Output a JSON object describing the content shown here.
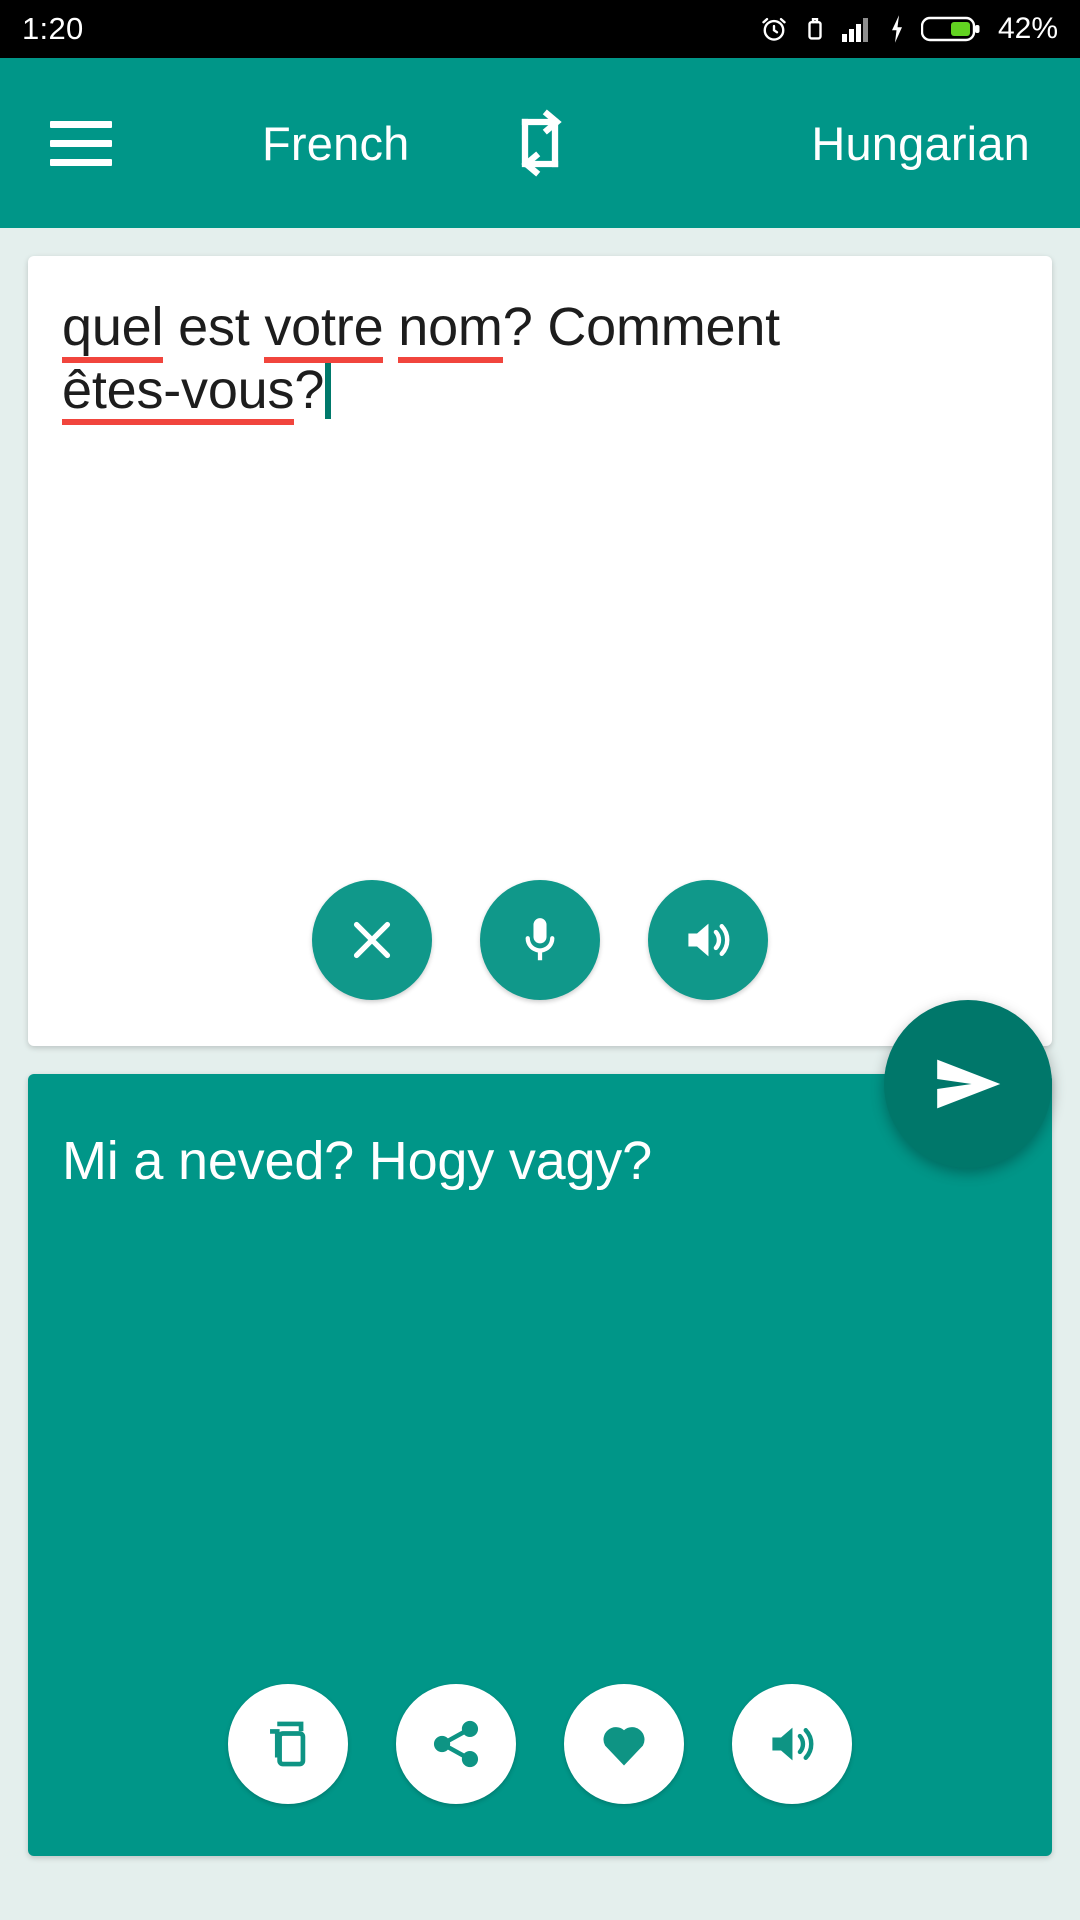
{
  "statusbar": {
    "time": "1:20",
    "battery_percent": "42%",
    "icons": [
      "alarm-icon",
      "vibrate-icon",
      "signal-icon",
      "charging-bolt-icon",
      "battery-icon"
    ]
  },
  "toolbar": {
    "menu_icon": "hamburger-menu-icon",
    "source_language": "French",
    "swap_icon": "swap-languages-icon",
    "target_language": "Hungarian",
    "background_color": "#009688"
  },
  "source": {
    "text_full": "quel est votre nom? Comment êtes-vous?",
    "tokens": [
      {
        "text": "quel",
        "misspelled": true
      },
      {
        "text": " ",
        "misspelled": false
      },
      {
        "text": "est",
        "misspelled": false
      },
      {
        "text": " ",
        "misspelled": false
      },
      {
        "text": "votre",
        "misspelled": true
      },
      {
        "text": " ",
        "misspelled": false
      },
      {
        "text": "nom",
        "misspelled": true
      },
      {
        "text": "? Comment ",
        "misspelled": false
      },
      {
        "text": "êtes-vous",
        "misspelled": true
      },
      {
        "text": "?",
        "misspelled": false
      }
    ],
    "caret_visible": true,
    "spellcheck_underline_color": "#f1453d",
    "caret_color": "#00796b",
    "actions": [
      {
        "name": "clear-button",
        "icon": "close-icon"
      },
      {
        "name": "voice-input-button",
        "icon": "microphone-icon"
      },
      {
        "name": "speak-source-button",
        "icon": "speaker-icon"
      }
    ]
  },
  "send": {
    "label": "send-button",
    "icon": "send-icon",
    "color": "#00776a"
  },
  "result": {
    "text": "Mi a neved? Hogy vagy?",
    "background_color": "#009688",
    "actions": [
      {
        "name": "copy-button",
        "icon": "copy-icon"
      },
      {
        "name": "share-button",
        "icon": "share-icon"
      },
      {
        "name": "favorite-button",
        "icon": "heart-icon"
      },
      {
        "name": "speak-result-button",
        "icon": "speaker-icon"
      }
    ]
  }
}
